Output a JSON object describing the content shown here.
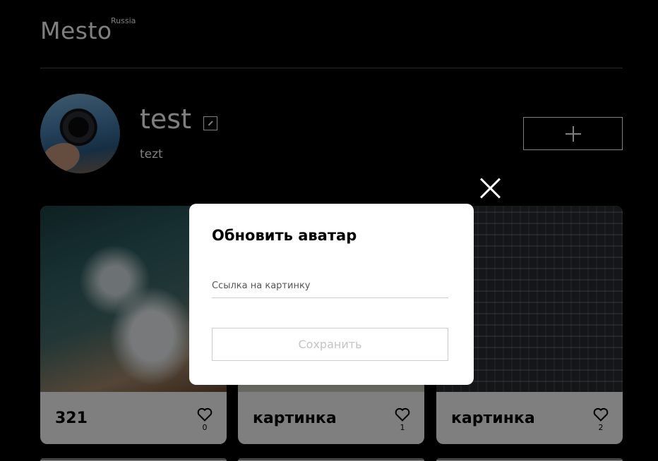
{
  "header": {
    "logo": "Mesto",
    "logo_suffix": "Russia"
  },
  "profile": {
    "name": "test",
    "about": "tezt"
  },
  "cards": [
    {
      "title": "321",
      "likes": "0"
    },
    {
      "title": "картинка",
      "likes": "1"
    },
    {
      "title": "картинка",
      "likes": "2"
    }
  ],
  "popup": {
    "title": "Обновить аватар",
    "input_placeholder": "Ссылка на картинку",
    "input_value": "",
    "submit_label": "Сохранить"
  },
  "icons": {
    "close": "close-icon",
    "edit": "pencil-icon",
    "add": "plus-icon",
    "like": "heart-icon"
  },
  "colors": {
    "background": "#000000",
    "card": "#ffffff",
    "disabled_text": "#c4c4c4"
  }
}
